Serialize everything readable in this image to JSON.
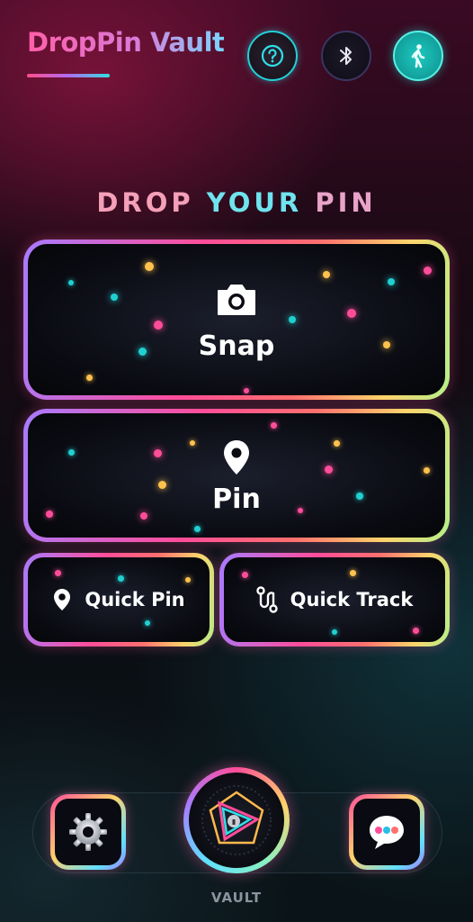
{
  "header": {
    "title": "DropPin Vault",
    "buttons": [
      {
        "icon": "help-icon"
      },
      {
        "icon": "bluetooth-icon"
      },
      {
        "icon": "walking-icon"
      }
    ]
  },
  "section": {
    "heading_part1": "DROP ",
    "heading_part2": "YOUR",
    "heading_part3": " PIN"
  },
  "actions": {
    "snap_label": "Snap",
    "pin_label": "Pin",
    "quick_pin_label": "Quick Pin",
    "quick_track_label": "Quick Track"
  },
  "dock": {
    "vault_label": "VAULT",
    "settings_icon": "gear-icon",
    "vault_icon": "vault-lock-icon",
    "chat_icon": "chat-bubble-icon"
  },
  "colors": {
    "accent_pink": "#ff4d9a",
    "accent_cyan": "#22d0d8",
    "accent_yellow": "#ffd36b",
    "accent_purple": "#a77bff"
  }
}
